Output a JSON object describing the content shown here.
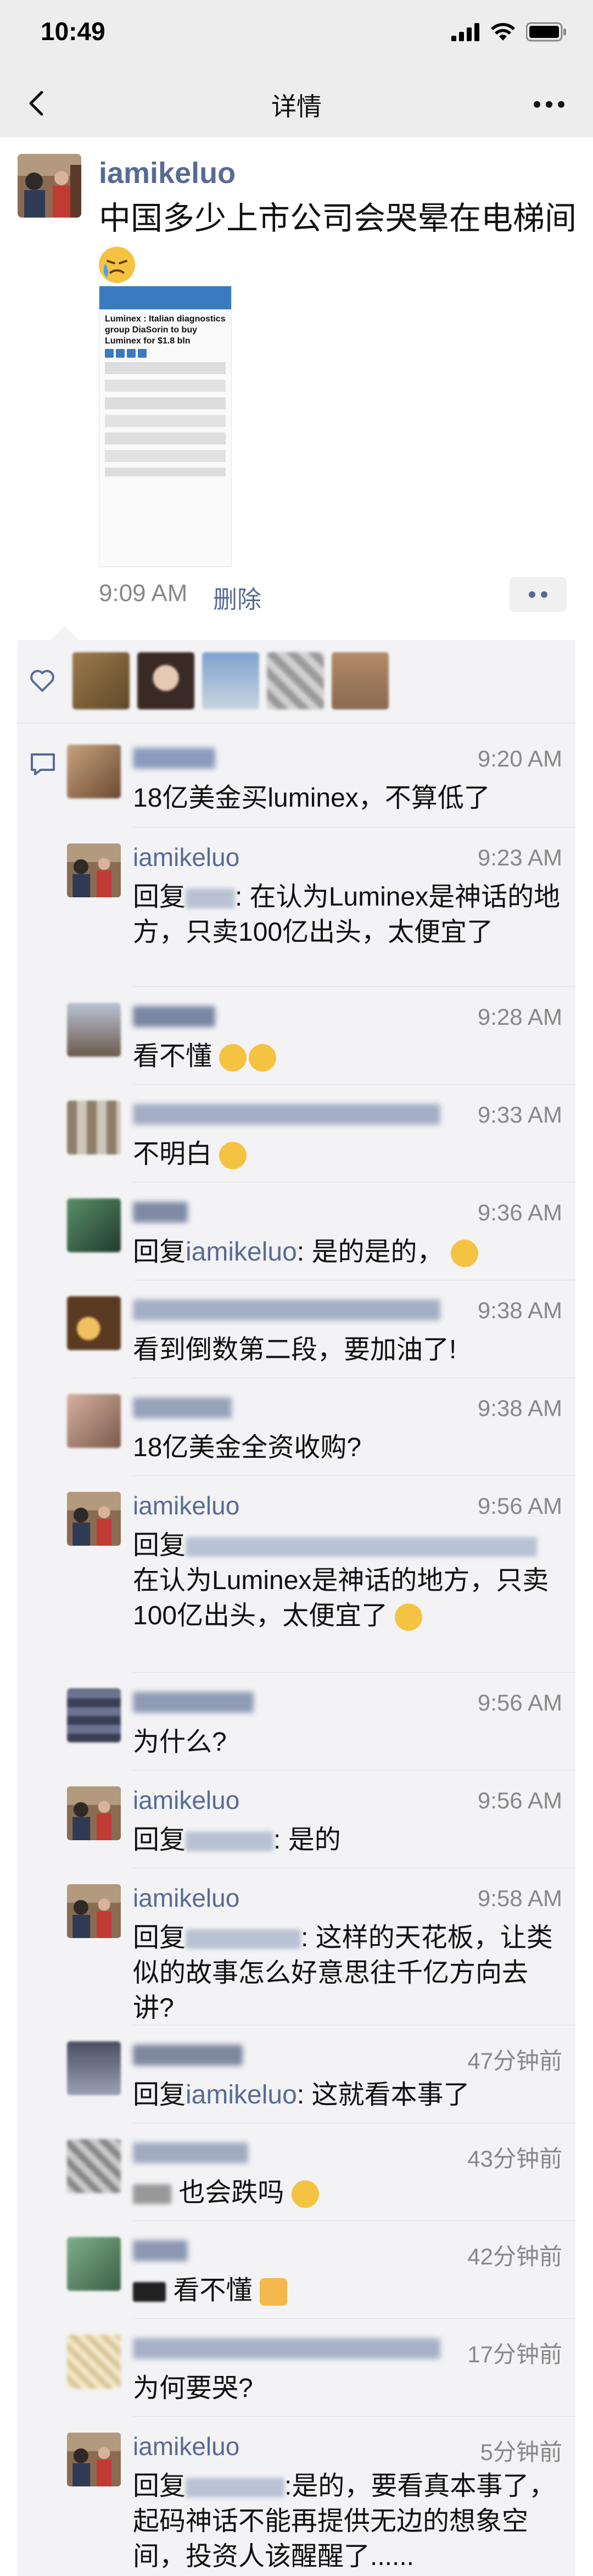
{
  "status_bar": {
    "time": "10:49"
  },
  "nav": {
    "title": "详情"
  },
  "post": {
    "author": "iamikeluo",
    "text": "中国多少上市公司会哭晕在电梯间",
    "image": {
      "headline": "Luminex : Italian diagnostics group DiaSorin to buy Luminex for $1.8 bln"
    },
    "time": "9:09 AM",
    "delete_label": "删除"
  },
  "comments": [
    {
      "name": "",
      "time": "9:20 AM",
      "text": "18亿美金买luminex，不算低了"
    },
    {
      "name": "iamikeluo",
      "time": "9:23 AM",
      "prefix": "回复",
      "suffix": ": 在认为Luminex是神话的地方，只卖100亿出头，太便宜了"
    },
    {
      "name": "",
      "time": "9:28 AM",
      "text": "看不懂"
    },
    {
      "name": "",
      "time": "9:33 AM",
      "text": "不明白"
    },
    {
      "name": "",
      "time": "9:36 AM",
      "prefix": "回复",
      "ref": "iamikeluo",
      "suffix": ": 是的是的，"
    },
    {
      "name": "",
      "time": "9:38 AM",
      "text": "看到倒数第二段，要加油了!"
    },
    {
      "name": "",
      "time": "9:38 AM",
      "text": "18亿美金全资收购?"
    },
    {
      "name": "iamikeluo",
      "time": "9:56 AM",
      "prefix": "回复",
      "suffix": " 在认为Luminex是神话的地方，只卖100亿出头，太便宜了"
    },
    {
      "name": "",
      "time": "9:56 AM",
      "text": "为什么?"
    },
    {
      "name": "iamikeluo",
      "time": "9:56 AM",
      "prefix": "回复",
      "suffix": ": 是的"
    },
    {
      "name": "iamikeluo",
      "time": "9:58 AM",
      "prefix": "回复",
      "suffix": ": 这样的天花板，让类似的故事怎么好意思往千亿方向去讲?"
    },
    {
      "name": "",
      "time": "47分钟前",
      "prefix": "回复",
      "ref": "iamikeluo",
      "suffix": ": 这就看本事了"
    },
    {
      "name": "",
      "time": "43分钟前",
      "text": "也会跌吗"
    },
    {
      "name": "",
      "time": "42分钟前",
      "text": "看不懂"
    },
    {
      "name": "",
      "time": "17分钟前",
      "text": "为何要哭?"
    },
    {
      "name": "iamikeluo",
      "time": "5分钟前",
      "prefix": "回复",
      "suffix": ":是的，要看真本事了，起码神话不能再提供无边的想象空间，投资人该醒醒了......"
    }
  ],
  "colors": {
    "link": "#576b95",
    "background": "#f3f3f5"
  }
}
